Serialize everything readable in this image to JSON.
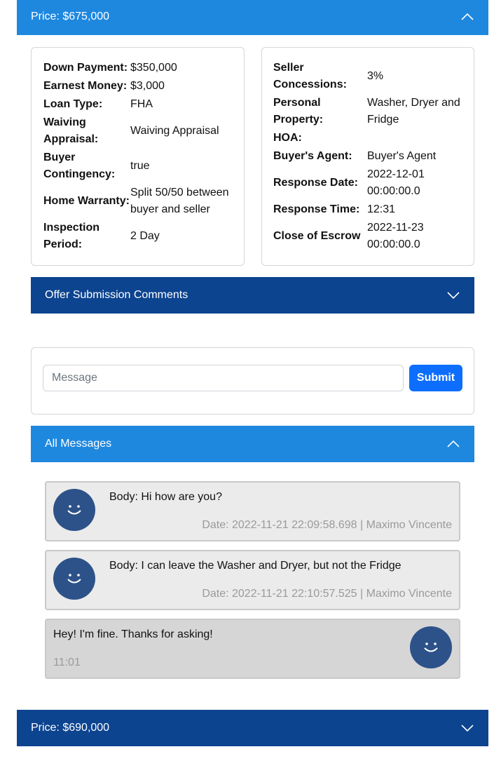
{
  "offer1": {
    "header_label": "Price: $675,000",
    "left_card": [
      {
        "label": "Down Payment:",
        "value": "$350,000"
      },
      {
        "label": "Earnest Money:",
        "value": "$3,000"
      },
      {
        "label": "Loan Type:",
        "value": "FHA"
      },
      {
        "label": "Waiving Appraisal:",
        "value": "Waiving Appraisal"
      },
      {
        "label": "Buyer Contingency:",
        "value": "true"
      },
      {
        "label": "Home Warranty:",
        "value": "Split 50/50 between buyer and seller"
      },
      {
        "label": "Inspection Period:",
        "value": "2 Day"
      }
    ],
    "right_card": [
      {
        "label": "Seller Concessions:",
        "value": "3%"
      },
      {
        "label": "Personal Property:",
        "value": "Washer, Dryer and Fridge"
      },
      {
        "label": "HOA:",
        "value": ""
      },
      {
        "label": "Buyer's Agent:",
        "value": "Buyer's Agent"
      },
      {
        "label": "Response Date:",
        "value": "2022-12-01 00:00:00.0"
      },
      {
        "label": "Response Time:",
        "value": "12:31"
      },
      {
        "label": "Close of Escrow",
        "value": "2022-11-23 00:00:00.0"
      }
    ],
    "comments_header": "Offer Submission Comments",
    "message_placeholder": "Message",
    "submit_label": "Submit",
    "messages_header": "All Messages",
    "messages": [
      {
        "body": "Body: Hi how are you?",
        "meta": "Date: 2022-11-21 22:09:58.698 | Maximo Vincente"
      },
      {
        "body": "Body: I can leave the Washer and Dryer, but not the Fridge",
        "meta": "Date: 2022-11-21 22:10:57.525 | Maximo Vincente"
      },
      {
        "body": "Hey! I'm fine. Thanks for asking!",
        "meta": "11:01"
      }
    ]
  },
  "offer2": {
    "header_label": "Price: $690,000"
  },
  "colors": {
    "accordion_open": "#1e88df",
    "accordion_closed": "#0c4490",
    "avatar": "#2d5289",
    "submit": "#0d6efd"
  },
  "icons": {
    "expanded": "chevron-up-icon",
    "collapsed": "chevron-down-icon",
    "avatar": "smiley-avatar-icon"
  }
}
